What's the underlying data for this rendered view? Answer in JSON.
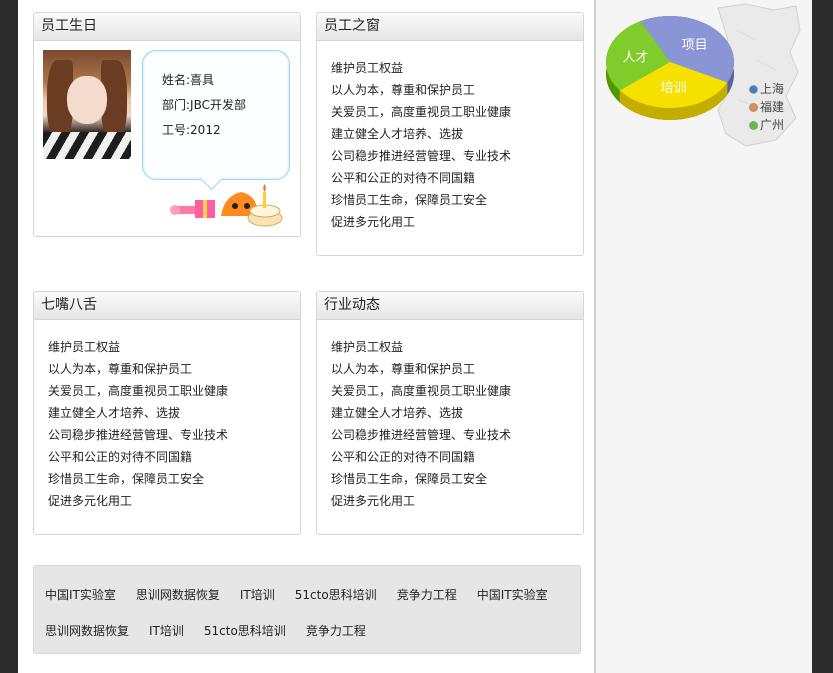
{
  "birthday": {
    "title": "员工生日",
    "name": "姓名:喜具",
    "department": "部门:JBC开发部",
    "id": "工号:2012"
  },
  "window_panel": {
    "title": "员工之窗",
    "items": [
      "维护员工权益",
      "以人为本，尊重和保护员工",
      "关爱员工，高度重视员工职业健康",
      "建立健全人才培养、选拔",
      "公司稳步推进经营管理、专业技术",
      "公平和公正的对待不同国籍",
      "珍惜员工生命，保障员工安全",
      "促进多元化用工"
    ]
  },
  "chat_panel": {
    "title": "七嘴八舌",
    "items": [
      "维护员工权益",
      "以人为本，尊重和保护员工",
      "关爱员工，高度重视员工职业健康",
      "建立健全人才培养、选拔",
      "公司稳步推进经营管理、专业技术",
      "公平和公正的对待不同国籍",
      "珍惜员工生命，保障员工安全",
      "促进多元化用工"
    ]
  },
  "news_panel": {
    "title": "行业动态",
    "items": [
      "维护员工权益",
      "以人为本，尊重和保护员工",
      "关爱员工，高度重视员工职业健康",
      "建立健全人才培养、选拔",
      "公司稳步推进经营管理、专业技术",
      "公平和公正的对待不同国籍",
      "珍惜员工生命，保障员工安全",
      "促进多元化用工"
    ]
  },
  "links": {
    "row1": [
      "中国IT实验室",
      "思训网数据恢复",
      "IT培训",
      "51cto思科培训",
      "竞争力工程",
      "中国IT实验室"
    ],
    "row2": [
      "思训网数据恢复",
      "IT培训",
      "51cto思科培训",
      "竞争力工程"
    ]
  },
  "chart_data": {
    "type": "pie",
    "labels": [
      "项目",
      "培训",
      "人才"
    ],
    "values": [
      40,
      32,
      28
    ],
    "colors": [
      "#8a95d6",
      "#f5e000",
      "#7fcc2a"
    ]
  },
  "side_legend": [
    {
      "label": "上海",
      "color": "#3a7bd5"
    },
    {
      "label": "福建",
      "color": "#f08a3a"
    },
    {
      "label": "广州",
      "color": "#5cc13b"
    }
  ]
}
